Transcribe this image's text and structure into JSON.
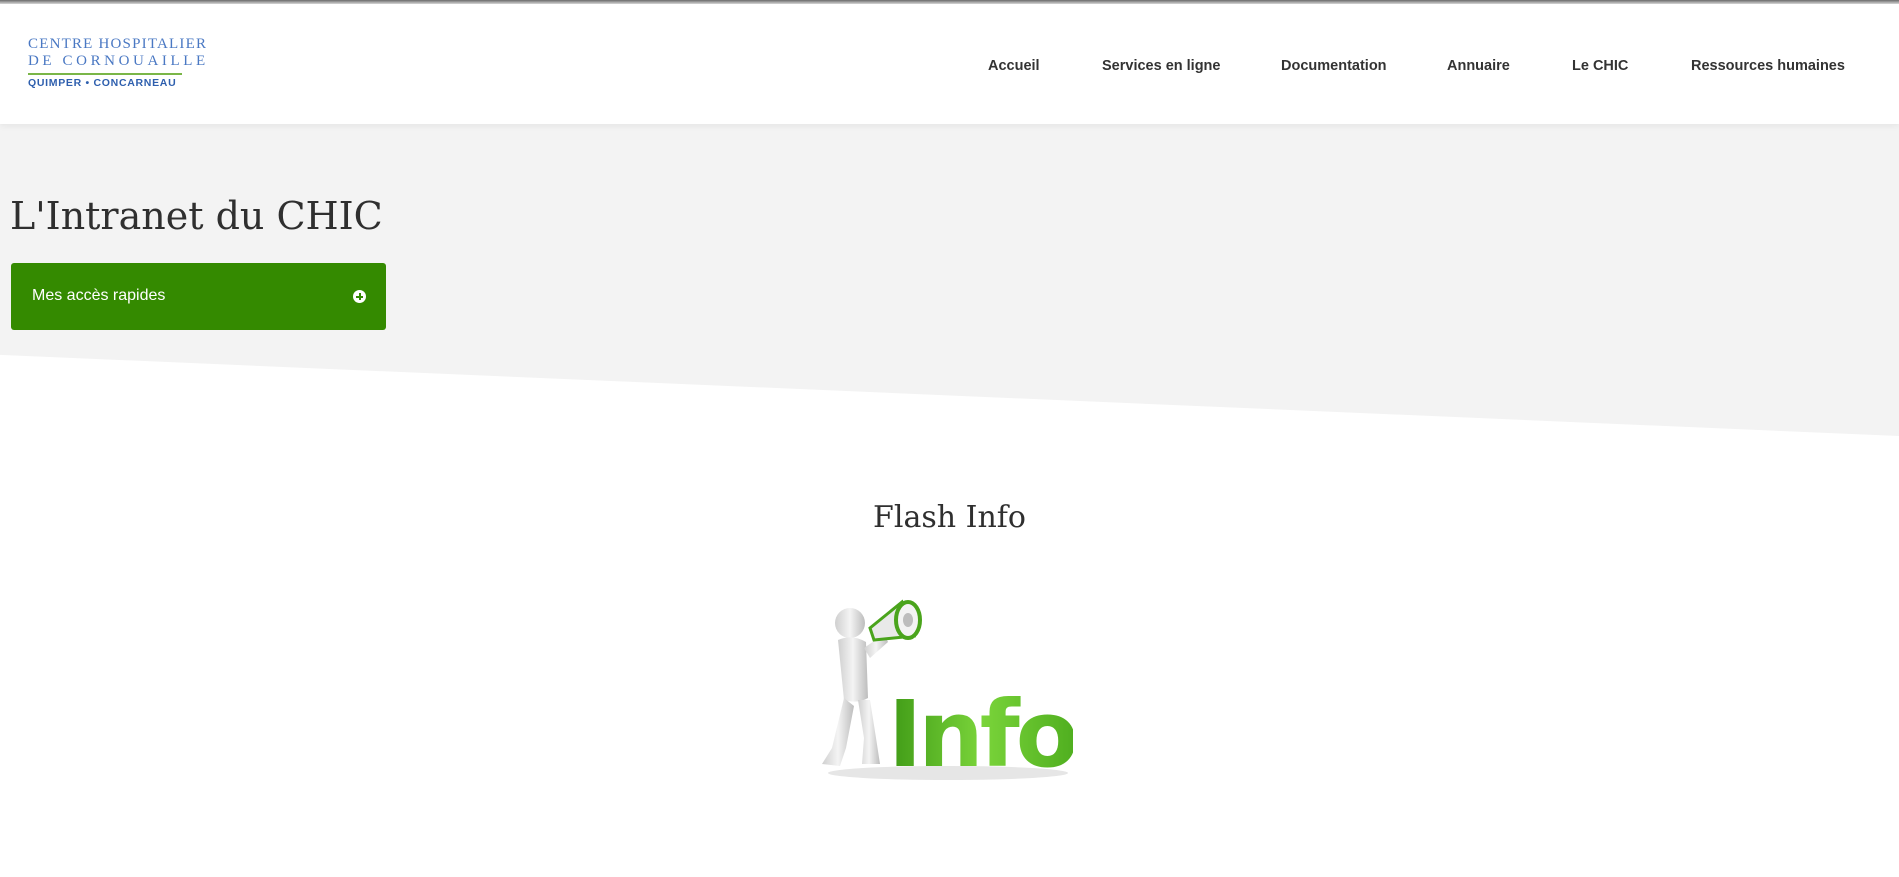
{
  "logo": {
    "line1": "CENTRE HOSPITALIER",
    "line2": "DE CORNOUAILLE",
    "line3": "QUIMPER • CONCARNEAU"
  },
  "nav": {
    "items": [
      {
        "label": "Accueil"
      },
      {
        "label": "Services en ligne"
      },
      {
        "label": "Documentation"
      },
      {
        "label": "Annuaire"
      },
      {
        "label": "Le CHIC"
      },
      {
        "label": "Ressources humaines"
      }
    ]
  },
  "hero": {
    "title": "L'Intranet du CHIC",
    "quick_access_label": "Mes accès rapides"
  },
  "flash": {
    "title": "Flash Info",
    "image_word": "Info",
    "image_alt": "megaphone-figure-info"
  },
  "colors": {
    "brand_green": "#348a00",
    "logo_blue": "#4a78c3",
    "hero_bg": "#f3f3f3",
    "info_green": "#6cc62c"
  }
}
